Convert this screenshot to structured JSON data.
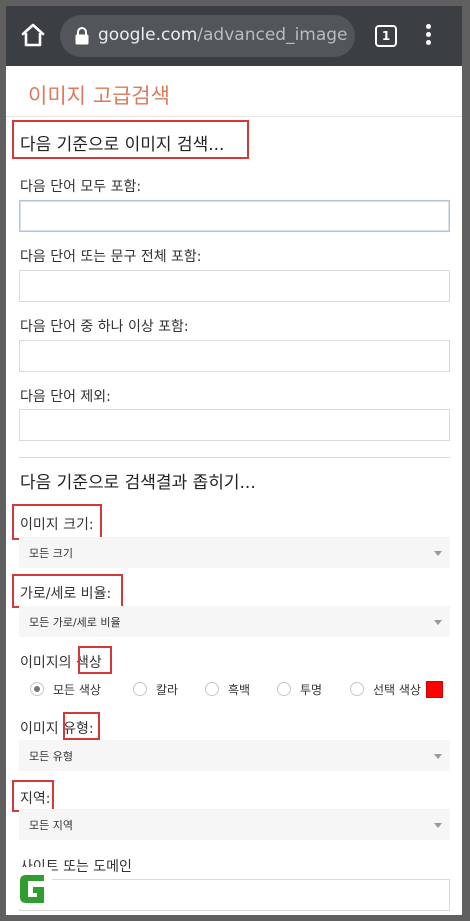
{
  "browser": {
    "url_host": "google.com",
    "url_path": "/advanced_image",
    "tab_count": "1",
    "icons": [
      "home-icon",
      "lock-icon",
      "tabs-icon",
      "more-vert-icon"
    ]
  },
  "page": {
    "title": "이미지 고급검색",
    "section1_heading": "다음 기준으로 이미지 검색...",
    "fields": {
      "all_words": {
        "label": "다음 단어 모두 포함:",
        "value": ""
      },
      "exact_phrase": {
        "label": "다음 단어 또는 문구 전체 포함:",
        "value": ""
      },
      "any_words": {
        "label": "다음 단어 중 하나 이상 포함:",
        "value": ""
      },
      "none_words": {
        "label": "다음 단어 제외:",
        "value": ""
      }
    },
    "section2_heading": "다음 기준으로 검색결과 좁히기...",
    "image_size": {
      "label": "이미지 크기:",
      "value": "모든 크기"
    },
    "aspect_ratio": {
      "label": "가로/세로 비율:",
      "value": "모든 가로/세로 비율"
    },
    "color": {
      "label_prefix": "이미지의 ",
      "label_highlight": "색상",
      "options": [
        "모든 색상",
        "칼라",
        "흑백",
        "투명",
        "선택 색상"
      ],
      "selected": "모든 색상",
      "swatch_color": "#ff0000"
    },
    "image_type": {
      "label_prefix": "이미지 ",
      "label_highlight": "유형",
      "label_suffix": ":",
      "value": "모든 유형"
    },
    "region": {
      "label": "지역:",
      "value": "모든 지역"
    },
    "site": {
      "label": "사이트 또는 도메인",
      "value": ""
    }
  },
  "colors": {
    "accent": "#dd7a5b",
    "highlight_box": "#d23a3a",
    "browser_bar": "#3b3f43",
    "logo_green": "#2e9e2e"
  }
}
